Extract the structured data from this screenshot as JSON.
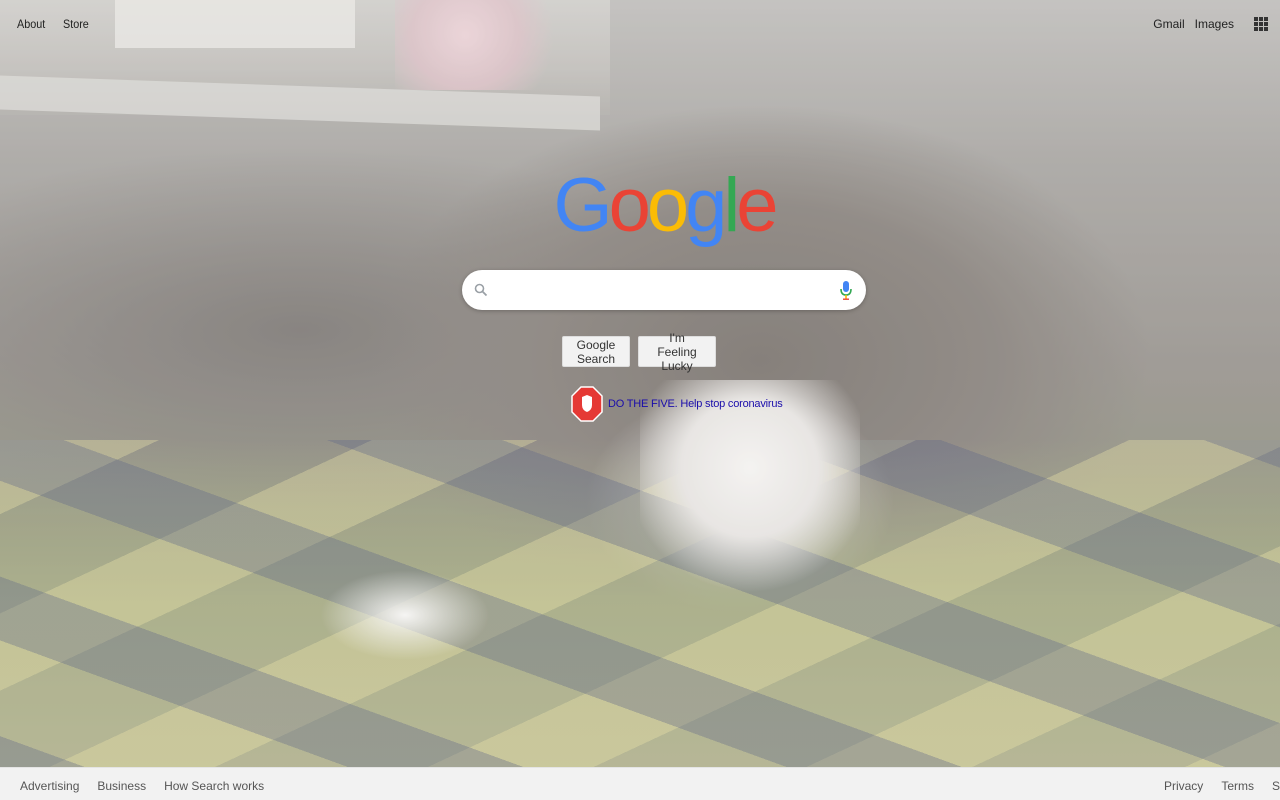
{
  "header": {
    "left_links": [
      "About",
      "Store"
    ],
    "right_links": [
      "Gmail",
      "Images"
    ],
    "apps_icon": "grid-apps-icon"
  },
  "logo": {
    "letters": [
      "G",
      "o",
      "o",
      "g",
      "l",
      "e"
    ],
    "colors": [
      "#4285f4",
      "#ea4335",
      "#fbbc05",
      "#4285f4",
      "#34a853",
      "#ea4335"
    ]
  },
  "search": {
    "value": "",
    "placeholder": "",
    "search_icon": "search-icon",
    "mic_icon": "microphone-icon"
  },
  "buttons": {
    "search_label": "Google Search",
    "lucky_label": "I'm Feeling Lucky"
  },
  "promo": {
    "icon": "stop-sign-shield-icon",
    "text": "DO THE FIVE. Help stop coronavirus",
    "color": "#1a0dab"
  },
  "footer": {
    "left_links": [
      "Advertising",
      "Business",
      "How Search works"
    ],
    "right_links": [
      "Privacy",
      "Terms",
      "S"
    ]
  }
}
